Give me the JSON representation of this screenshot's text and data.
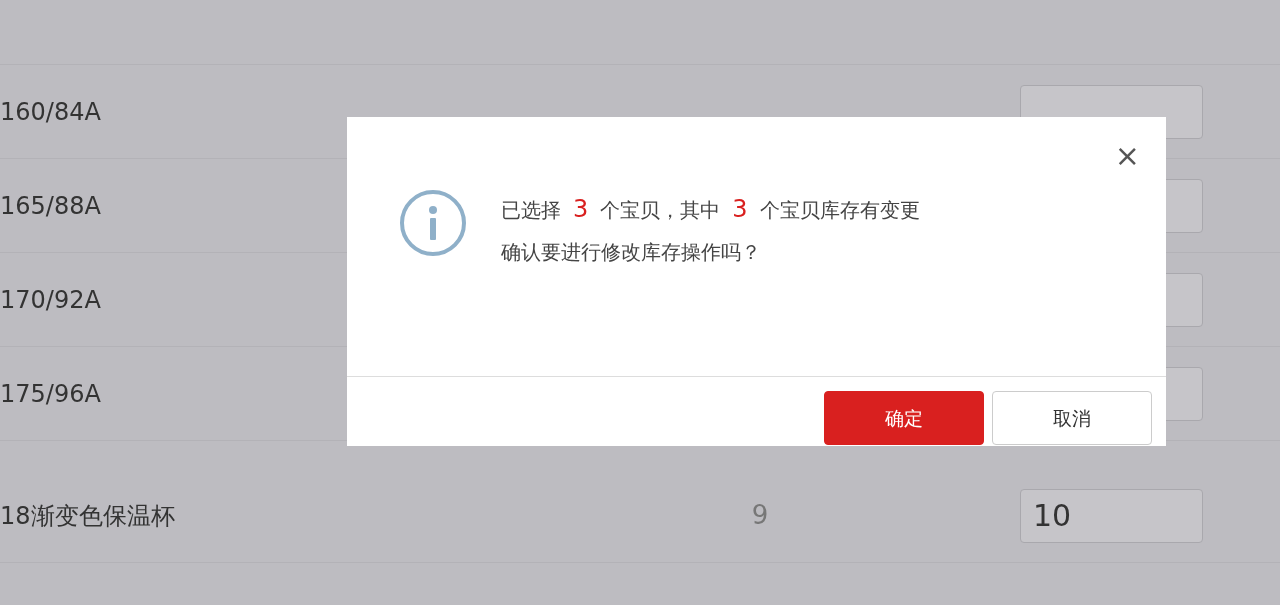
{
  "rows": [
    {
      "name": "160/84A"
    },
    {
      "name": "165/88A"
    },
    {
      "name": "170/92A"
    },
    {
      "name": "175/96A"
    }
  ],
  "product_row": {
    "name": "18渐变色保温杯",
    "stock": "9",
    "value": "10"
  },
  "dialog": {
    "close": "×",
    "message_lines": [
      {
        "parts": [
          {
            "kind": "text",
            "text": "已选择"
          },
          {
            "kind": "count",
            "text": "3"
          },
          {
            "kind": "text",
            "text": "个宝贝，其中"
          },
          {
            "kind": "count",
            "text": "3"
          },
          {
            "kind": "text",
            "text": "个宝贝库存有变更"
          }
        ]
      },
      {
        "parts": [
          {
            "kind": "text",
            "text": "确认要进行修改库存操作吗？"
          }
        ]
      }
    ],
    "buttons": [
      {
        "kind": "primary",
        "label": "确定"
      },
      {
        "kind": "secondary",
        "label": "取消"
      }
    ]
  }
}
